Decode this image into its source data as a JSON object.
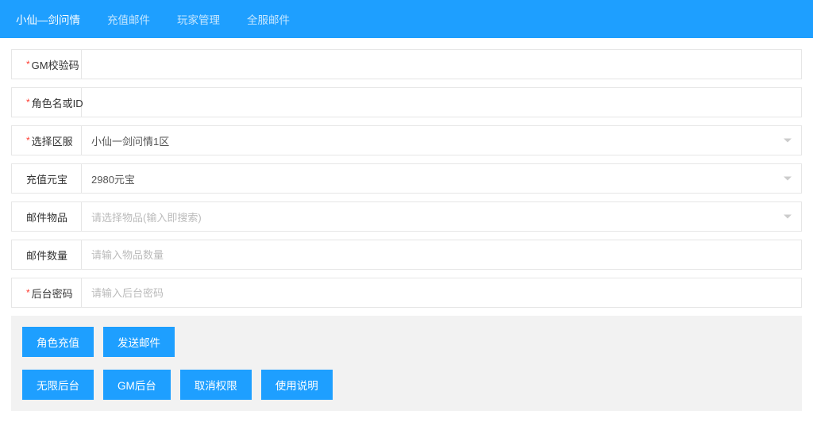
{
  "nav": {
    "items": [
      {
        "label": "小仙—剑问情",
        "active": true
      },
      {
        "label": "充值邮件",
        "active": false
      },
      {
        "label": "玩家管理",
        "active": false
      },
      {
        "label": "全服邮件",
        "active": false
      }
    ]
  },
  "form": {
    "gm_code": {
      "label": "GM校验码",
      "value": "",
      "required": true
    },
    "role": {
      "label": "角色名或ID",
      "value": "",
      "required": true
    },
    "server": {
      "label": "选择区服",
      "value": "小仙一剑问情1区",
      "required": true
    },
    "yuanbao": {
      "label": "充值元宝",
      "value": "2980元宝",
      "required": false
    },
    "item": {
      "label": "邮件物品",
      "placeholder": "请选择物品(输入即搜索)",
      "value": "",
      "required": false
    },
    "quantity": {
      "label": "邮件数量",
      "placeholder": "请输入物品数量",
      "value": "",
      "required": false
    },
    "password": {
      "label": "后台密码",
      "placeholder": "请输入后台密码",
      "value": "",
      "required": true
    }
  },
  "buttons": {
    "row1": [
      {
        "label": "角色充值"
      },
      {
        "label": "发送邮件"
      }
    ],
    "row2": [
      {
        "label": "无限后台"
      },
      {
        "label": "GM后台"
      },
      {
        "label": "取消权限"
      },
      {
        "label": "使用说明"
      }
    ]
  }
}
